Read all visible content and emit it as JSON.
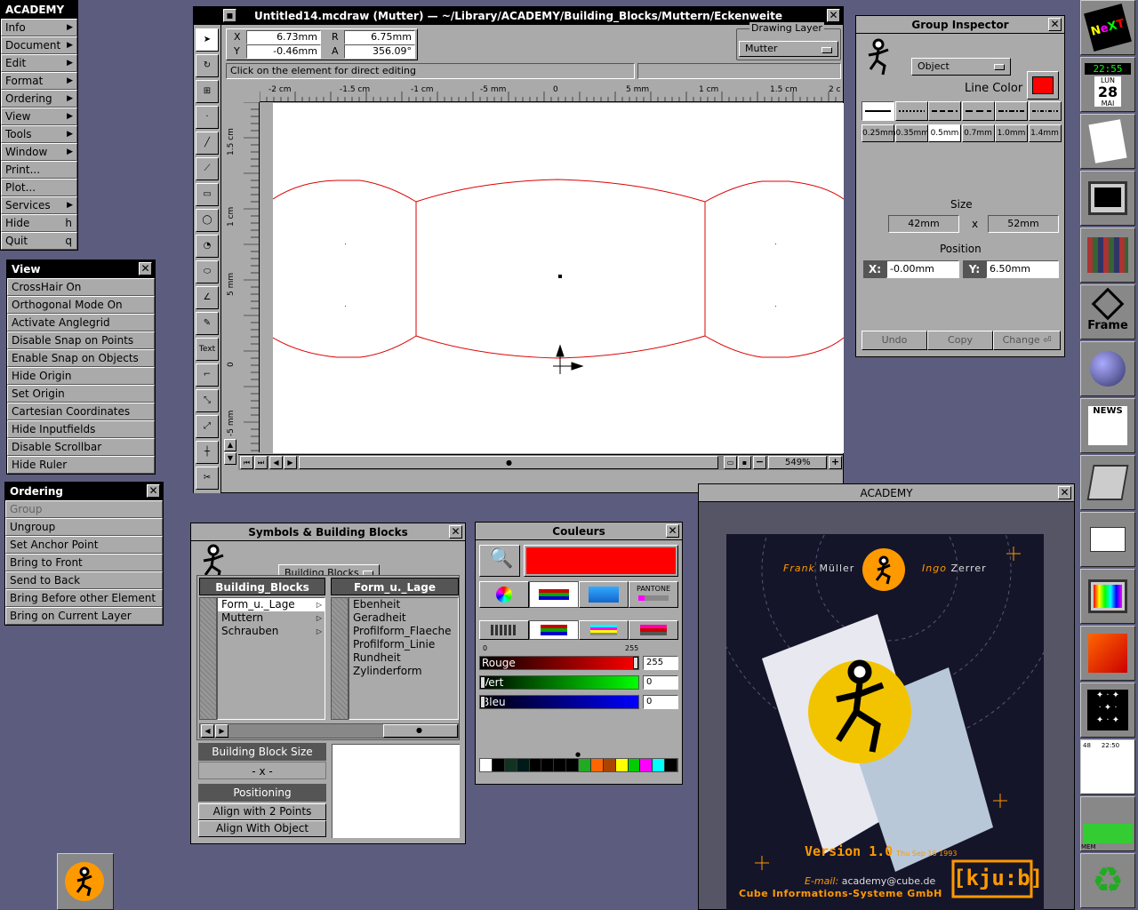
{
  "main_menu": {
    "title": "ACADEMY",
    "items": [
      {
        "label": "Info",
        "submenu": true
      },
      {
        "label": "Document",
        "submenu": true
      },
      {
        "label": "Edit",
        "submenu": true
      },
      {
        "label": "Format",
        "submenu": true
      },
      {
        "label": "Ordering",
        "submenu": true
      },
      {
        "label": "View",
        "submenu": true
      },
      {
        "label": "Tools",
        "submenu": true
      },
      {
        "label": "Window",
        "submenu": true
      },
      {
        "label": "Print...",
        "key": ""
      },
      {
        "label": "Plot...",
        "key": ""
      },
      {
        "label": "Services",
        "submenu": true
      },
      {
        "label": "Hide",
        "key": "h"
      },
      {
        "label": "Quit",
        "key": "q"
      }
    ]
  },
  "view_menu": {
    "title": "View",
    "items": [
      "CrossHair On",
      "Orthogonal Mode On",
      "Activate Anglegrid",
      "Disable Snap on Points",
      "Enable Snap on Objects",
      "Hide Origin",
      "Set Origin",
      "Cartesian Coordinates",
      "Hide Inputfields",
      "Disable Scrollbar",
      "Hide Ruler"
    ]
  },
  "ordering_menu": {
    "title": "Ordering",
    "items": [
      {
        "label": "Group",
        "disabled": true
      },
      {
        "label": "Ungroup",
        "disabled": false
      },
      {
        "label": "Set Anchor Point",
        "disabled": false
      },
      {
        "label": "Bring to Front",
        "disabled": false
      },
      {
        "label": "Send to Back",
        "disabled": false
      },
      {
        "label": "Bring Before other Element",
        "disabled": false
      },
      {
        "label": "Bring on Current Layer",
        "disabled": false
      }
    ]
  },
  "draw_window": {
    "title": "Untitled14.mcdraw (Mutter)  —  ~/Library/ACADEMY/Building_Blocks/Muttern/Eckenweite",
    "x_label": "X",
    "x_value": "6.73mm",
    "y_label": "Y",
    "y_value": "-0.46mm",
    "r_label": "R",
    "r_value": "6.75mm",
    "a_label": "A",
    "a_value": "356.09°",
    "layer_label": "Drawing Layer",
    "layer_value": "Mutter",
    "status": "Click on the element for direct editing",
    "zoom": "549%",
    "ruler_h": [
      "-2 cm",
      "-1.5 cm",
      "-1 cm",
      "-5 mm",
      "0",
      "5 mm",
      "1 cm",
      "1.5 cm",
      "2 c"
    ],
    "ruler_v": [
      "1.5 cm",
      "1 cm",
      "5 mm",
      "0",
      "-5 mm"
    ],
    "tools": [
      "select",
      "rotate",
      "grid",
      "point",
      "line",
      "dimension",
      "rectangle",
      "circle",
      "arc",
      "ellipse",
      "angle",
      "freehand",
      "Text",
      "step",
      "scale-a",
      "scale-b",
      "cross",
      "scissors"
    ]
  },
  "group_inspector": {
    "title": "Group Inspector",
    "popup": "Object",
    "line_color_label": "Line Color",
    "line_color": "#ff0000",
    "widths": [
      "0.25mm",
      "0.35mm",
      "0.5mm",
      "0.7mm",
      "1.0mm",
      "1.4mm"
    ],
    "size_label": "Size",
    "size_w": "42mm",
    "size_x": "x",
    "size_h": "52mm",
    "position_label": "Position",
    "pos_x_label": "X:",
    "pos_x": "-0.00mm",
    "pos_y_label": "Y:",
    "pos_y": "6.50mm",
    "undo": "Undo",
    "copy": "Copy",
    "change": "Change"
  },
  "symbols": {
    "title": "Symbols & Building Blocks",
    "popup": "Building Blocks",
    "col1_head": "Building_Blocks",
    "col1_items": [
      "Form_u._Lage",
      "Muttern",
      "Schrauben"
    ],
    "col2_head": "Form_u._Lage",
    "col2_items": [
      "Ebenheit",
      "Geradheit",
      "Profilform_Flaeche",
      "Profilform_Linie",
      "Rundheit",
      "Zylinderform"
    ],
    "bbsize": "Building Block Size",
    "bbsize_value": "- x -",
    "positioning": "Positioning",
    "align2": "Align with 2 Points",
    "alignobj": "Align With Object"
  },
  "couleurs": {
    "title": "Couleurs",
    "pantone": "PANTONE",
    "scale_min": "0",
    "scale_max": "255",
    "rouge": "Rouge",
    "rouge_val": "255",
    "vert": "Vert",
    "vert_val": "0",
    "bleu": "Bleu",
    "bleu_val": "0",
    "current": "#ff0000",
    "swatches": [
      "#ffffff",
      "#000000",
      "#113322",
      "#001a1a",
      "#000000",
      "#000000",
      "#000000",
      "#000000",
      "#22aa22",
      "#ff6600",
      "#aa4400",
      "#ffff00",
      "#00cc00",
      "#ff00ff",
      "#00ffff",
      "#000000"
    ]
  },
  "academy": {
    "title": "ACADEMY",
    "author1a": "Frank",
    "author1b": "Müller",
    "author2a": "Ingo",
    "author2b": "Zerrer",
    "version": "Version 1.0",
    "date": "Thu Sep 16 1993",
    "email_label": "E-mail:",
    "email": "academy@cube.de",
    "company": "Cube Informations-Systeme GmbH",
    "brand": "[kju:b]"
  },
  "dock": {
    "clock": "22:55",
    "day": "LUN",
    "date": "28",
    "month": "MAI",
    "frame": "Frame",
    "news": "NEWS",
    "mem": "MEM",
    "load_t1": "48",
    "load_t2": "22:50"
  },
  "colors": {
    "desktop": "#5c5c7e",
    "accent_red": "#ff0000",
    "orange": "#ff9900"
  }
}
